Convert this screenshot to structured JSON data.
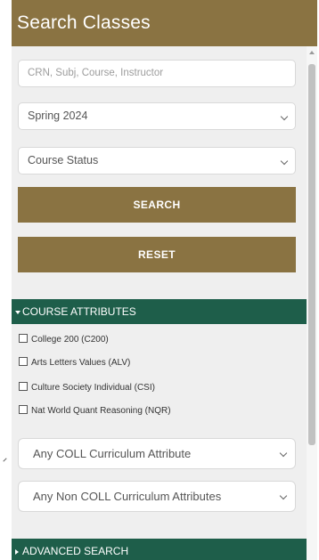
{
  "header": {
    "title": "Search Classes"
  },
  "search": {
    "placeholder": "CRN, Subj, Course, Instructor",
    "value": ""
  },
  "term_select": {
    "selected": "Spring 2024"
  },
  "status_select": {
    "selected": "Course Status"
  },
  "buttons": {
    "search_label": "SEARCH",
    "reset_label": "RESET"
  },
  "course_attributes": {
    "label": "COURSE ATTRIBUTES",
    "items": [
      {
        "label": "College 200 (C200)",
        "checked": false
      },
      {
        "label": "Arts Letters Values (ALV)",
        "checked": false
      },
      {
        "label": "Culture Society Individual (CSI)",
        "checked": false
      },
      {
        "label": "Nat World Quant Reasoning (NQR)",
        "checked": false
      }
    ],
    "coll_select": {
      "selected": "Any COLL Curriculum Attribute"
    },
    "non_coll_select": {
      "selected": "Any Non COLL Curriculum Attributes"
    }
  },
  "advanced": {
    "label": "ADVANCED SEARCH"
  },
  "colors": {
    "brand_gold": "#8a7342",
    "section_green": "#1e5e4a",
    "panel_bg": "#efefef"
  },
  "icons": {
    "expanded": "triangle-down-icon",
    "collapsed": "triangle-right-icon",
    "dropdown": "chevron-down-icon"
  }
}
